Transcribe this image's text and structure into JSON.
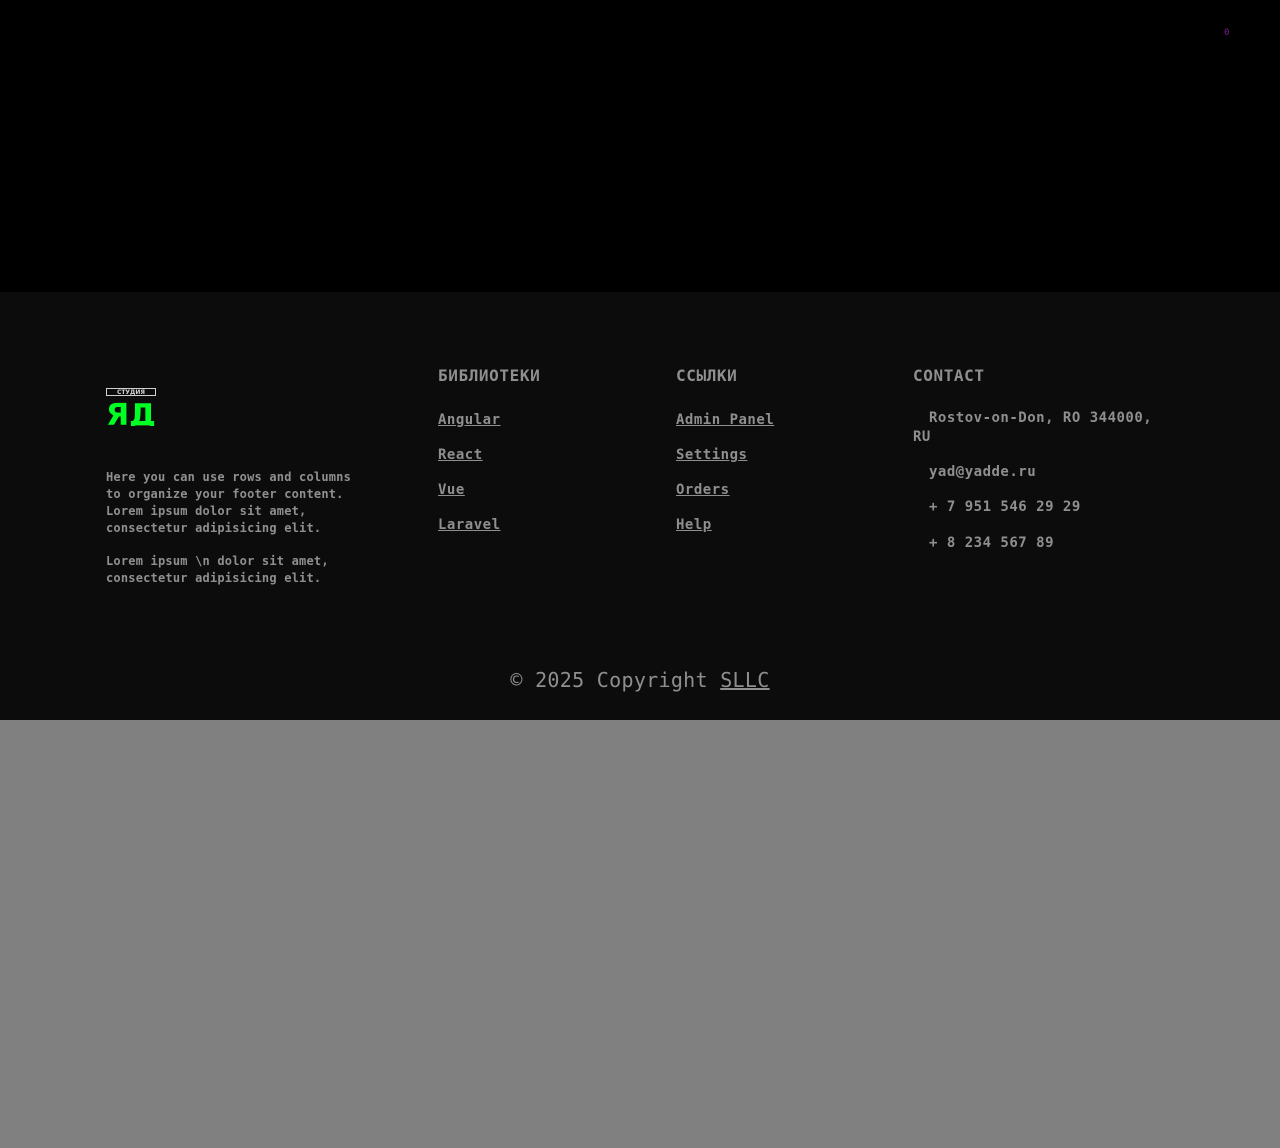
{
  "top": {
    "badge_text": "0"
  },
  "footer": {
    "logo": {
      "top_text": "СТУДИЯ",
      "letters": "ЯД",
      "accent": "#00ff22"
    },
    "description": [
      "Here you can use rows and columns to organize your footer content. Lorem ipsum dolor sit amet, consectetur adipisicing elit.",
      "Lorem ipsum \\n dolor sit amet, consectetur adipisicing elit."
    ],
    "libraries": {
      "heading": "БИБЛИОТЕКИ",
      "items": [
        "Angular",
        "React",
        "Vue",
        "Laravel"
      ]
    },
    "links": {
      "heading": "ССЫЛКИ",
      "items": [
        "Admin Panel",
        "Settings",
        "Orders",
        "Help"
      ]
    },
    "contact": {
      "heading": "CONTACT",
      "items": [
        "Rostov-on-Don, RO 344000, RU",
        "yad@yadde.ru",
        "+ 7 951 546 29 29",
        "+ 8 234 567 89"
      ]
    },
    "copyright": {
      "prefix": "© 2025 Copyright",
      "link": "SLLC"
    }
  },
  "colors": {
    "top_bg": "#000000",
    "footer_bg": "#0c0c0c",
    "page_bg": "#808080",
    "text": "#8f8f8f",
    "badge": "#7a1e8f"
  }
}
